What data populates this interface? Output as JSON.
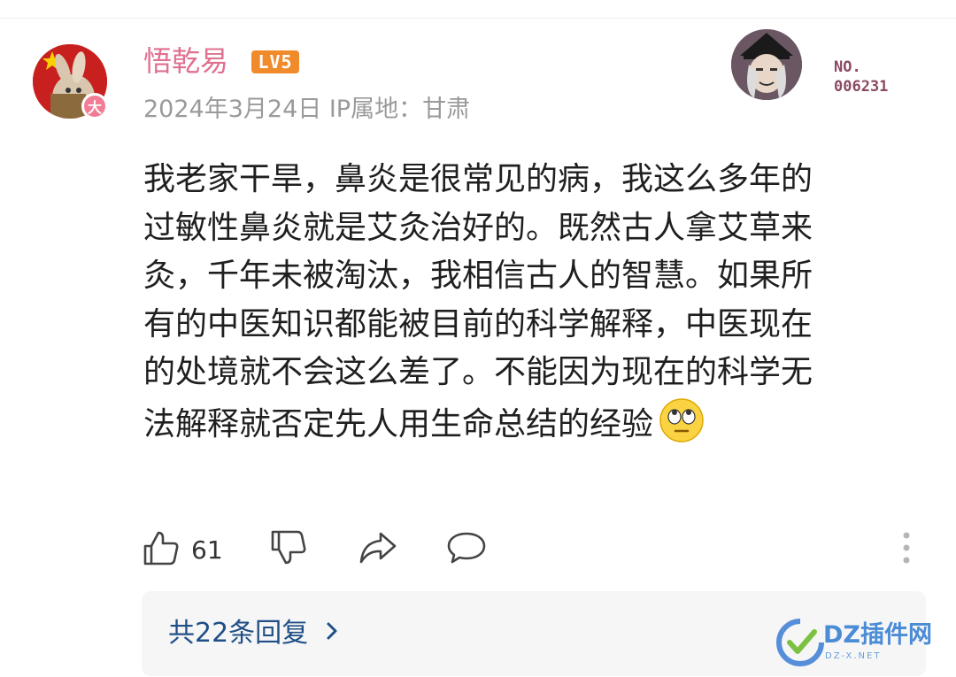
{
  "user": {
    "name": "悟乾易",
    "level": "LV5",
    "avatar_badge": "大",
    "date": "2024年3月24日",
    "ip_label": "IP属地：",
    "ip_location": "甘肃"
  },
  "decoration": {
    "no_label": "NO.",
    "number": "006231"
  },
  "comment": {
    "lines": [
      "我老家干旱，鼻炎是很常见的病，我这么多年的",
      "过敏性鼻炎就是艾灸治好的。既然古人拿艾草来",
      "灸，千年未被淘汰，我相信古人的智慧。如果所",
      "有的中医知识都能被目前的科学解释，中医现在",
      "的处境就不会这么差了。不能因为现在的科学无",
      "法解释就否定先人用生命总结的经验"
    ],
    "emoji": "eye-roll-emoji"
  },
  "actions": {
    "like_count": "61"
  },
  "replies": {
    "label": "共22条回复"
  },
  "watermark": {
    "text": "DZ插件网",
    "sub": "DZ-X.NET"
  },
  "colors": {
    "username": "#e0708f",
    "level_badge": "#f08a2a",
    "reply_link": "#1f4f86",
    "meta": "#9a9a9a"
  }
}
